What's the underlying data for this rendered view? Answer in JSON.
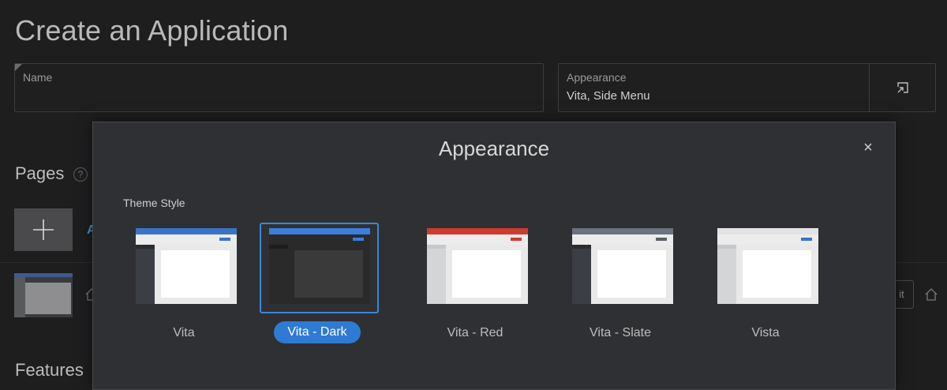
{
  "page": {
    "title": "Create an Application"
  },
  "form": {
    "name_label": "Name",
    "name_value": "",
    "appearance_label": "Appearance",
    "appearance_value": "Vita, Side Menu"
  },
  "sections": {
    "pages_title": "Pages",
    "pages_help": "?",
    "add_link_partial": "A",
    "edit_partial": "it",
    "features_title": "Features"
  },
  "dialog": {
    "title": "Appearance",
    "close_glyph": "×",
    "theme_style_label": "Theme Style",
    "selected_theme": "Vita - Dark",
    "themes": [
      {
        "name": "Vita",
        "top": "#3b74c6",
        "bar": "#ececec",
        "btn": "#3b74c6",
        "side": "#3b3f45",
        "side_dark": "#2a2d31",
        "bg": "#e9e9ea"
      },
      {
        "name": "Vita - Dark",
        "top": "#3b7ddc",
        "bar": "#2a2a2b",
        "btn": "#3b7ddc",
        "side": "#2a2a2b",
        "side_dark": "#1d1d1e",
        "bg": "#2a2a2b",
        "content": "#3a3a3b"
      },
      {
        "name": "Vita - Red",
        "top": "#d03a2f",
        "bar": "#ececec",
        "btn": "#d03a2f",
        "side": "#d4d5d7",
        "side_dark": "#c7c8ca",
        "bg": "#e9e9ea"
      },
      {
        "name": "Vita - Slate",
        "top": "#6b7380",
        "bar": "#ececec",
        "btn": "#5a606a",
        "side": "#3b3f45",
        "side_dark": "#2a2d31",
        "bg": "#e9e9ea"
      },
      {
        "name": "Vista",
        "top": "#e3e3e4",
        "bar": "#ececec",
        "btn": "#3b74c6",
        "side": "#d4d5d7",
        "side_dark": "#c7c8ca",
        "bg": "#e9e9ea"
      }
    ]
  }
}
